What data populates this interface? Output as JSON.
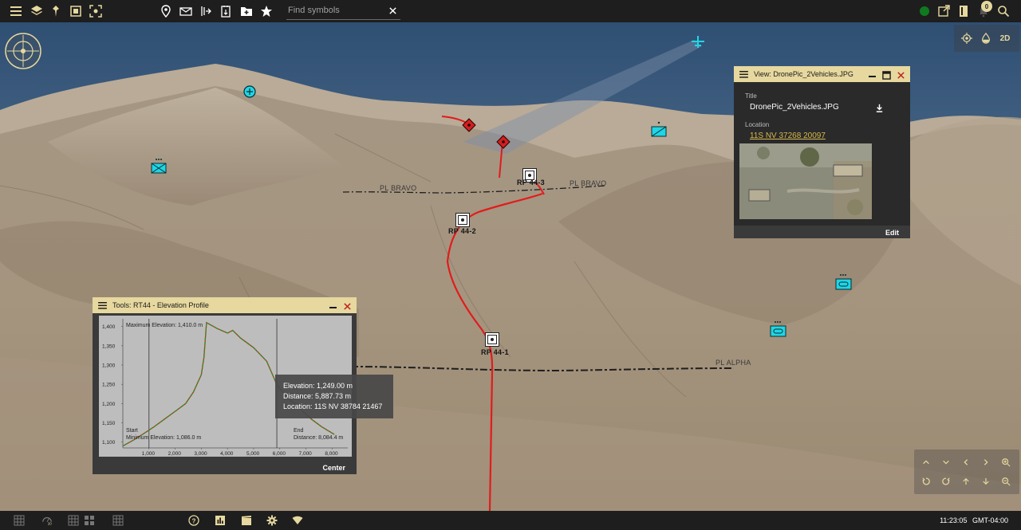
{
  "toolbar": {
    "search_placeholder": "Find symbols",
    "notifications_count": "0",
    "icons": [
      "menu-icon",
      "layers-icon",
      "pin-tool-icon",
      "frame-icon",
      "focus-icon",
      "map-marker-icon",
      "envelope-icon",
      "route-arrow-icon",
      "document-icon",
      "add-folder-icon",
      "star-icon",
      "status-dot-icon",
      "external-link-icon",
      "notebook-icon",
      "bell-icon",
      "search-icon"
    ],
    "status_color": "#0f7a1e",
    "accent_color": "#d7b94c"
  },
  "view_controls": {
    "mode_2d": "2D"
  },
  "map": {
    "phase_lines": {
      "bravo_left": "PL BRAVO",
      "bravo_right": "PL BRAVO",
      "alpha": "PL ALPHA"
    },
    "route_points": [
      "RP 44-3",
      "RP 44-2",
      "RP 44-1"
    ],
    "route_color": "#e31b1b",
    "friendly_color": "#1fd5e6",
    "hostile_color": "#d31f1f"
  },
  "view_panel": {
    "header": "View: DronePic_2Vehicles.JPG",
    "title_label": "Title",
    "title_value": "DronePic_2Vehicles.JPG",
    "location_label": "Location",
    "location_value": "11S NV 37268 20097",
    "edit_label": "Edit"
  },
  "elevation_panel": {
    "header": "Tools: RT44 - Elevation Profile",
    "max_label": "Maximum Elevation: 1,410.0 m",
    "min_label": "Minimum Elevation: 1,086.0 m",
    "start_label": "Start",
    "end_label": "End",
    "distance_label": "Distance: 8,084.4 m",
    "center_label": "Center"
  },
  "tooltip": {
    "elevation": "Elevation: 1,249.00 m",
    "distance": "Distance:  5,887.73 m",
    "location": "Location:  11S NV 38784 21467"
  },
  "chart_data": {
    "type": "line",
    "xlabel": "",
    "ylabel": "",
    "x_ticks": [
      "1,000",
      "2,000",
      "3,000",
      "4,000",
      "5,000",
      "6,000",
      "7,000",
      "8,000"
    ],
    "y_ticks": [
      "1,100",
      "1,150",
      "1,200",
      "1,250",
      "1,300",
      "1,350",
      "1,400"
    ],
    "xlim": [
      0,
      8600
    ],
    "ylim": [
      1085,
      1420
    ],
    "x": [
      0,
      400,
      800,
      1200,
      1600,
      2000,
      2400,
      2700,
      2900,
      3000,
      3100,
      3200,
      3600,
      4000,
      4200,
      4500,
      5000,
      5500,
      5888,
      6300,
      6800,
      7200,
      7600,
      8084
    ],
    "values": [
      1090,
      1105,
      1122,
      1140,
      1160,
      1180,
      1200,
      1230,
      1260,
      1275,
      1320,
      1410,
      1395,
      1383,
      1390,
      1370,
      1345,
      1310,
      1249,
      1215,
      1185,
      1160,
      1140,
      1120
    ],
    "markers": [
      {
        "x": 1000
      },
      {
        "x": 5888
      }
    ],
    "series": [
      {
        "name": "",
        "color": "#1f9a2a"
      }
    ]
  },
  "bottom_bar": {
    "icons": [
      "grid-icon",
      "measure-20-icon",
      "grid-tools-icon",
      "grid-layout-icon",
      "grid-settings-icon",
      "help-icon",
      "chart-icon",
      "film-icon",
      "gear-icon",
      "wifi-icon"
    ],
    "time": "11:23:05",
    "timezone": "GMT-04:00"
  }
}
